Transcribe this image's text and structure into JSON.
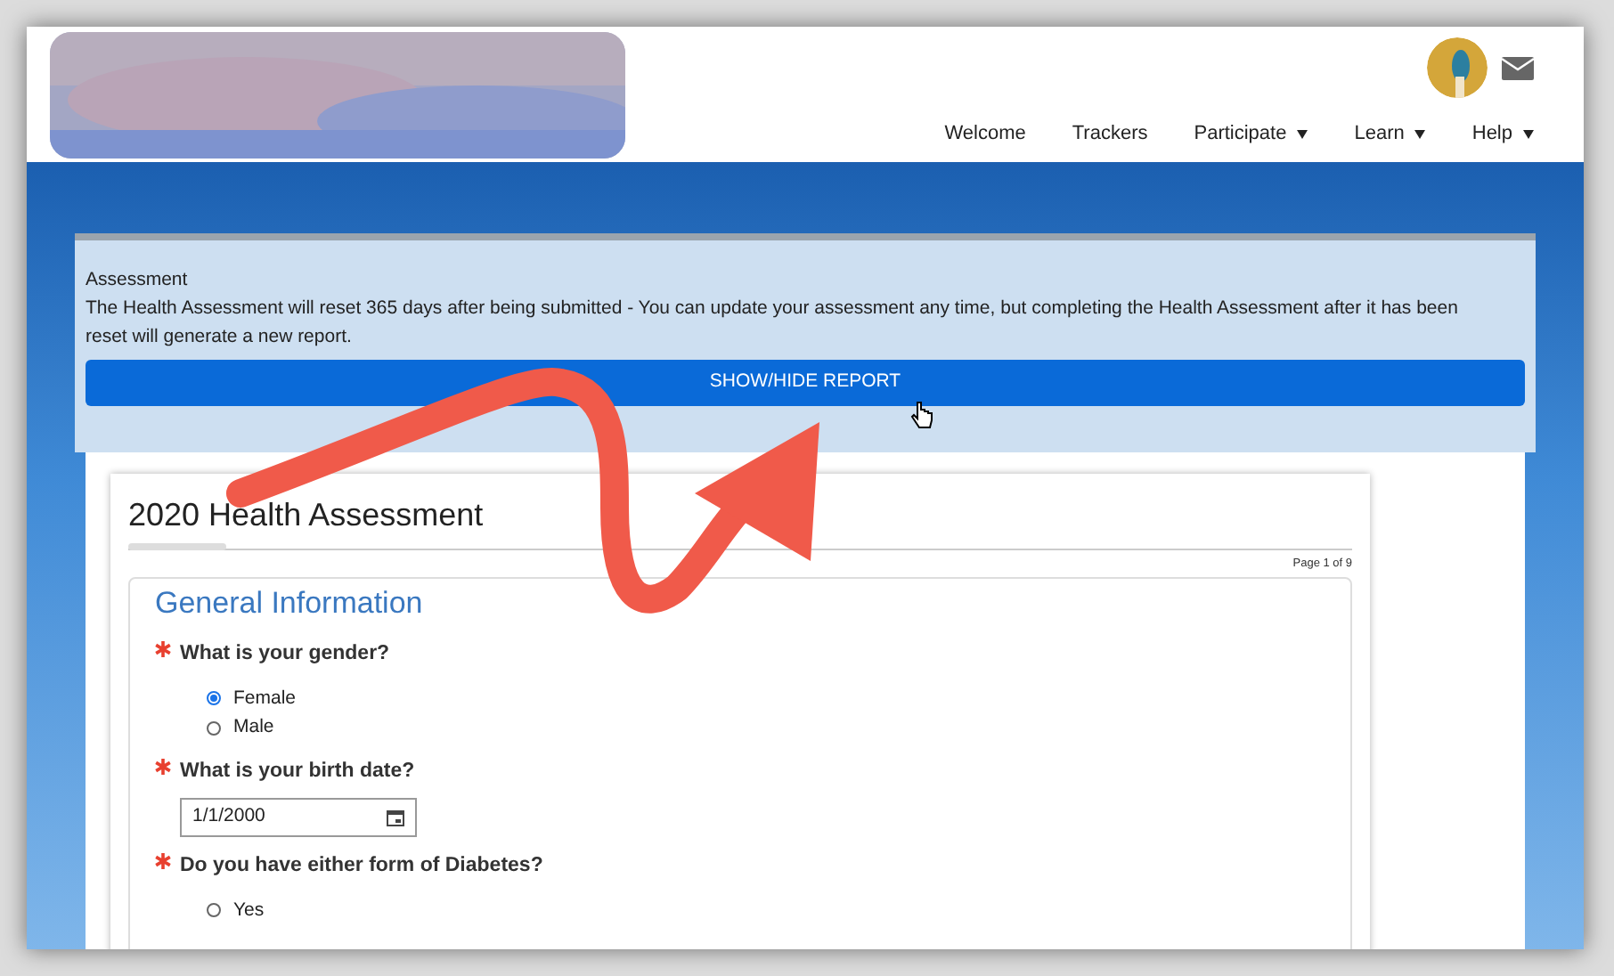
{
  "nav": [
    {
      "label": "Welcome",
      "dropdown": false
    },
    {
      "label": "Trackers",
      "dropdown": false
    },
    {
      "label": "Participate",
      "dropdown": true
    },
    {
      "label": "Learn",
      "dropdown": true
    },
    {
      "label": "Help",
      "dropdown": true
    }
  ],
  "notice": {
    "title": "Assessment",
    "text": "The Health Assessment will reset 365 days after being submitted - You can update your assessment any time, but completing the Health Assessment after it has been reset will generate a new report.",
    "button": "SHOW/HIDE REPORT"
  },
  "form": {
    "title": "2020 Health Assessment",
    "progress": {
      "level": 0.08
    },
    "page": "Page 1 of 9",
    "section": "General Information",
    "questions": [
      {
        "kind": "radio",
        "label": "What is your gender?",
        "required": true,
        "options": [
          {
            "label": "Female",
            "selected": true
          },
          {
            "label": "Male",
            "selected": false
          }
        ]
      },
      {
        "kind": "date",
        "label": "What is your birth date?",
        "required": true,
        "value": "1/1/2000"
      },
      {
        "kind": "radio",
        "label": "Do you have either form of Diabetes?",
        "required": true,
        "options": [
          {
            "label": "Yes",
            "selected": false
          }
        ]
      }
    ]
  }
}
